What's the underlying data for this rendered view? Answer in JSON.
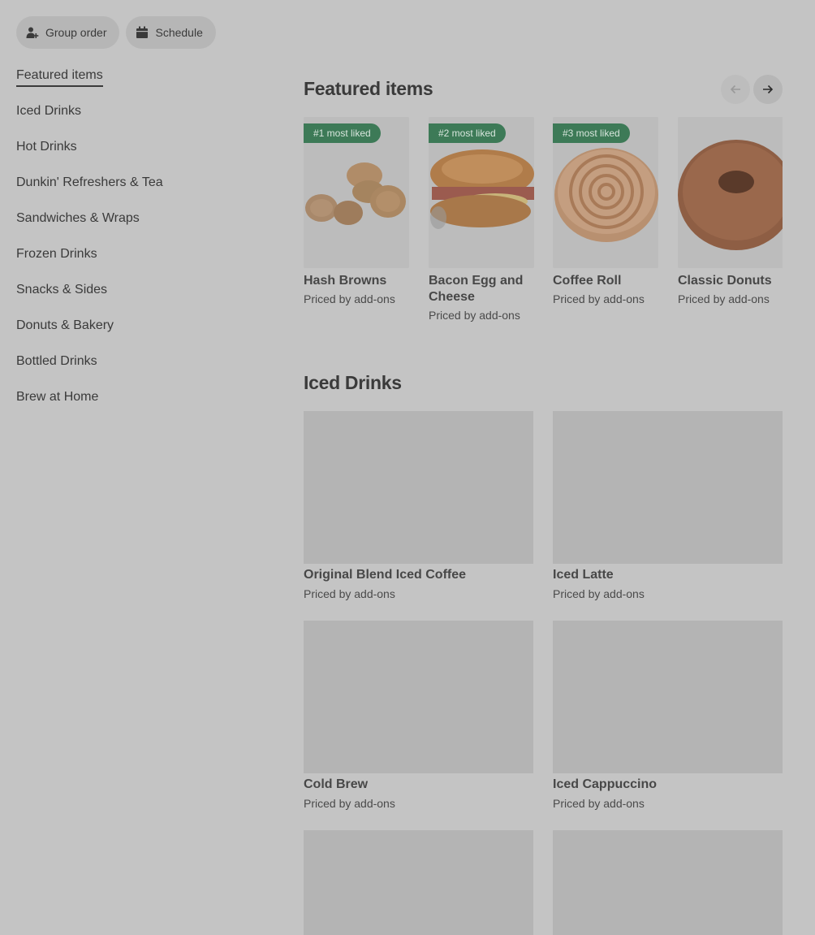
{
  "top_actions": {
    "group_order_label": "Group order",
    "schedule_label": "Schedule"
  },
  "side_nav": {
    "items": [
      {
        "label": "Featured items",
        "active": true
      },
      {
        "label": "Iced Drinks"
      },
      {
        "label": "Hot Drinks"
      },
      {
        "label": "Dunkin' Refreshers & Tea"
      },
      {
        "label": "Sandwiches & Wraps"
      },
      {
        "label": "Frozen Drinks"
      },
      {
        "label": "Snacks & Sides"
      },
      {
        "label": "Donuts & Bakery"
      },
      {
        "label": "Bottled Drinks"
      },
      {
        "label": "Brew at Home"
      }
    ]
  },
  "featured": {
    "title": "Featured items",
    "items": [
      {
        "badge": "#1 most liked",
        "name": "Hash Browns",
        "price": "Priced by add-ons",
        "icon": "hash-browns-image"
      },
      {
        "badge": "#2 most liked",
        "name": "Bacon Egg and Cheese",
        "price": "Priced by add-ons",
        "icon": "bagel-sandwich-image"
      },
      {
        "badge": "#3 most liked",
        "name": "Coffee Roll",
        "price": "Priced by add-ons",
        "icon": "coffee-roll-image"
      },
      {
        "name": "Classic Donuts",
        "price": "Priced by add-ons",
        "icon": "donut-image"
      }
    ]
  },
  "iced": {
    "title": "Iced Drinks",
    "items": [
      {
        "name": "Original Blend Iced Coffee",
        "price": "Priced by add-ons"
      },
      {
        "name": "Iced Latte",
        "price": "Priced by add-ons"
      },
      {
        "name": "Cold Brew",
        "price": "Priced by add-ons"
      },
      {
        "name": "Iced Cappuccino",
        "price": "Priced by add-ons"
      }
    ]
  },
  "colors": {
    "overlay_background": "#c4c4c4",
    "badge_green": "#3d7a57",
    "text": "#3a3a3a"
  }
}
